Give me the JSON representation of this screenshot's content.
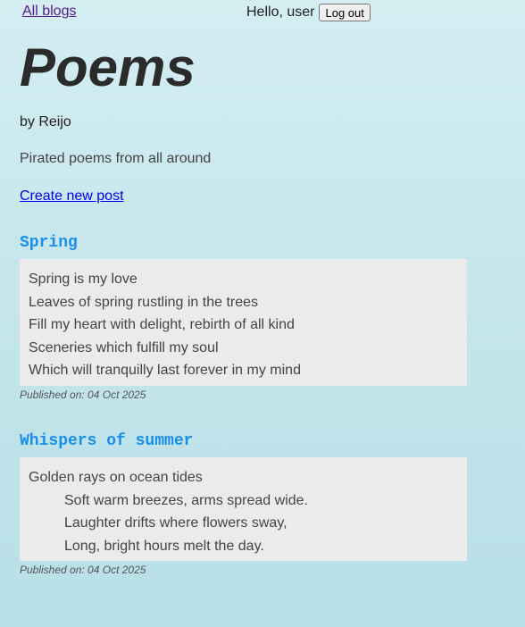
{
  "nav": {
    "all_blogs": "All blogs",
    "greeting": "Hello, user",
    "logout": "Log out"
  },
  "blog": {
    "title": "Poems",
    "author": "by Reijo",
    "description": "Pirated poems from all around",
    "create_post": "Create new post"
  },
  "posts": [
    {
      "title": "Spring",
      "lines": [
        "Spring is my love",
        "Leaves of spring rustling in the trees",
        "Fill my heart with delight, rebirth of all kind",
        "Sceneries which fulfill my soul",
        "Which will tranquilly last forever in my mind"
      ],
      "published": "Published on: 04 Oct 2025"
    },
    {
      "title": "Whispers of summer",
      "lines": [
        "Golden rays on ocean tides",
        "Soft warm breezes, arms spread wide.",
        "Laughter drifts where flowers sway,",
        "Long, bright hours melt the day."
      ],
      "published": "Published on: 04 Oct 2025"
    }
  ],
  "colors": {
    "post_title": "#1a8fe8",
    "post_background": "#ebebeb",
    "visited_link": "#551a8b",
    "link": "#0000ee"
  }
}
